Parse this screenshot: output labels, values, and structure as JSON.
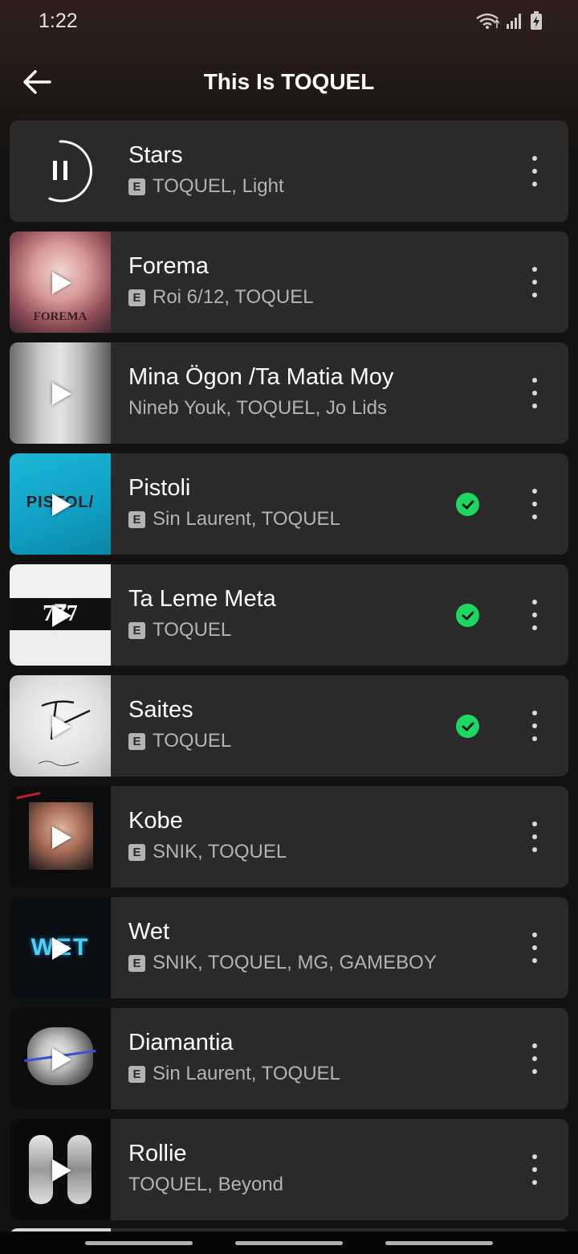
{
  "status_bar": {
    "time": "1:22"
  },
  "header": {
    "title": "This Is TOQUEL"
  },
  "colors": {
    "accent": "#1ed760",
    "row_bg": "#2a2a2a",
    "page_bg": "#121212"
  },
  "tracks": [
    {
      "title": "Stars",
      "artists": "TOQUEL, Light",
      "explicit": true,
      "downloaded": false,
      "playing": true
    },
    {
      "title": "Forema",
      "artists": "Roi 6/12, TOQUEL",
      "explicit": true,
      "downloaded": false,
      "art_text": "FOREMA"
    },
    {
      "title": "Mina Ögon /Ta Matia Moy",
      "artists": "Nineb Youk, TOQUEL, Jo Lids",
      "explicit": false,
      "downloaded": false
    },
    {
      "title": "Pistoli",
      "artists": "Sin Laurent, TOQUEL",
      "explicit": true,
      "downloaded": true,
      "art_text": "PISTOL/"
    },
    {
      "title": "Ta Leme Meta",
      "artists": "TOQUEL",
      "explicit": true,
      "downloaded": true,
      "art_text": "7𝟕7"
    },
    {
      "title": "Saites",
      "artists": "TOQUEL",
      "explicit": true,
      "downloaded": true
    },
    {
      "title": "Kobe",
      "artists": "SNIK, TOQUEL",
      "explicit": true,
      "downloaded": false
    },
    {
      "title": "Wet",
      "artists": "SNIK, TOQUEL, MG, GAMEBOY",
      "explicit": true,
      "downloaded": false,
      "art_text": "WET"
    },
    {
      "title": "Diamantia",
      "artists": "Sin Laurent, TOQUEL",
      "explicit": true,
      "downloaded": false
    },
    {
      "title": "Rollie",
      "artists": "TOQUEL, Beyond",
      "explicit": false,
      "downloaded": false
    }
  ]
}
